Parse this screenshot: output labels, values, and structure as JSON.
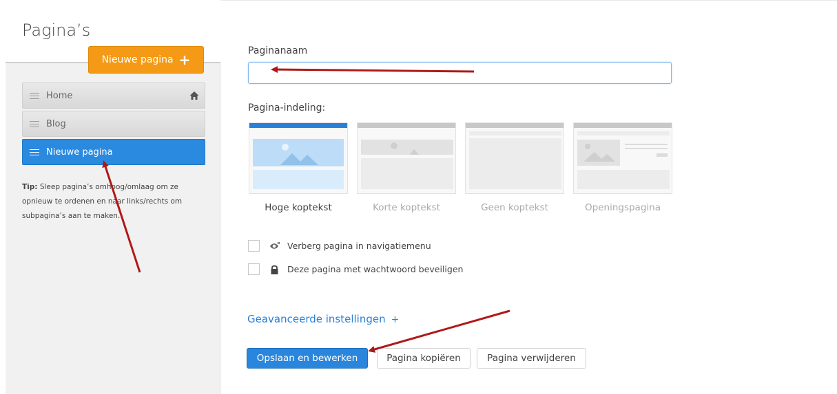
{
  "sidebar": {
    "title": "Pagina’s",
    "new_page_label": "Nieuwe pagina",
    "items": [
      {
        "label": "Home"
      },
      {
        "label": "Blog"
      },
      {
        "label": "Nieuwe pagina"
      }
    ],
    "tip_label": "Tip:",
    "tip_text": "Sleep pagina’s omhoog/omlaag om ze opnieuw te ordenen en naar links/rechts om subpagina’s aan te maken."
  },
  "form": {
    "name_label": "Paginanaam",
    "name_value": "",
    "layout_label": "Pagina-indeling:",
    "layouts": [
      {
        "label": "Hoge koptekst"
      },
      {
        "label": "Korte koptekst"
      },
      {
        "label": "Geen koptekst"
      },
      {
        "label": "Openingspagina"
      }
    ],
    "hide_nav_label": "Verberg pagina in navigatiemenu",
    "password_label": "Deze pagina met wachtwoord beveiligen",
    "advanced_label": "Geavanceerde instellingen",
    "save_label": "Opslaan en bewerken",
    "copy_label": "Pagina kopiëren",
    "delete_label": "Pagina verwijderen"
  },
  "colors": {
    "accent_orange": "#f59a16",
    "accent_blue": "#2a86dc",
    "arrow_red": "#b01818"
  }
}
